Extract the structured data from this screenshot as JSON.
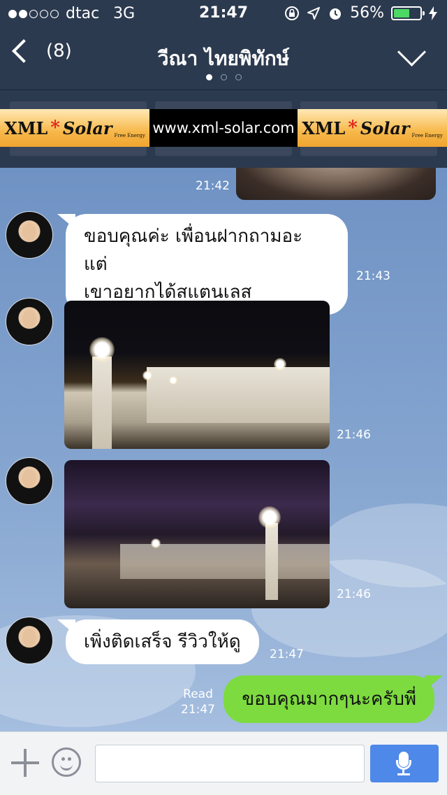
{
  "status_bar": {
    "carrier": "dtac",
    "network": "3G",
    "time": "21:47",
    "battery": "56%",
    "signal_bars_filled": 2,
    "signal_bars_total": 5,
    "battery_level": 0.56
  },
  "header": {
    "back_label": "(8)",
    "title": "วีณา ไทยพิทักษ์",
    "page_indicator": {
      "count": 3,
      "active": 0
    }
  },
  "banner": {
    "brand_left": "XML",
    "star": "*",
    "brand_right": "Solar",
    "tagline": "Free Energy",
    "url": "www.xml-solar.com"
  },
  "messages": [
    {
      "type": "image-partial",
      "time": "21:42"
    },
    {
      "type": "text",
      "sender": "other",
      "line1": "ขอบคุณค่ะ เพื่อนฝากถามอะ แต่",
      "line2": "เขาอยากได้สแตนเลส",
      "time": "21:43"
    },
    {
      "type": "image",
      "sender": "other",
      "time": "21:46"
    },
    {
      "type": "image",
      "sender": "other",
      "time": "21:46"
    },
    {
      "type": "text",
      "sender": "other",
      "line1": "เพิ่งติดเสร็จ รีวิวให้ดู",
      "time": "21:47"
    },
    {
      "type": "text",
      "sender": "me",
      "line1": "ขอบคุณมากๆนะครับพี่",
      "read": "Read",
      "time": "21:47"
    }
  ],
  "colors": {
    "header_bg": "#2c3a4f",
    "my_bubble": "#7ddb3f",
    "mic_button": "#4e88e8"
  },
  "icons": {
    "back": "chevron-left-icon",
    "menu": "chevron-down-icon",
    "location": "location-arrow-icon",
    "alarm": "alarm-icon",
    "lock_rotation": "rotation-lock-icon",
    "charging": "bolt-icon",
    "add": "plus-icon",
    "sticker": "smiley-icon",
    "voice": "microphone-icon"
  }
}
